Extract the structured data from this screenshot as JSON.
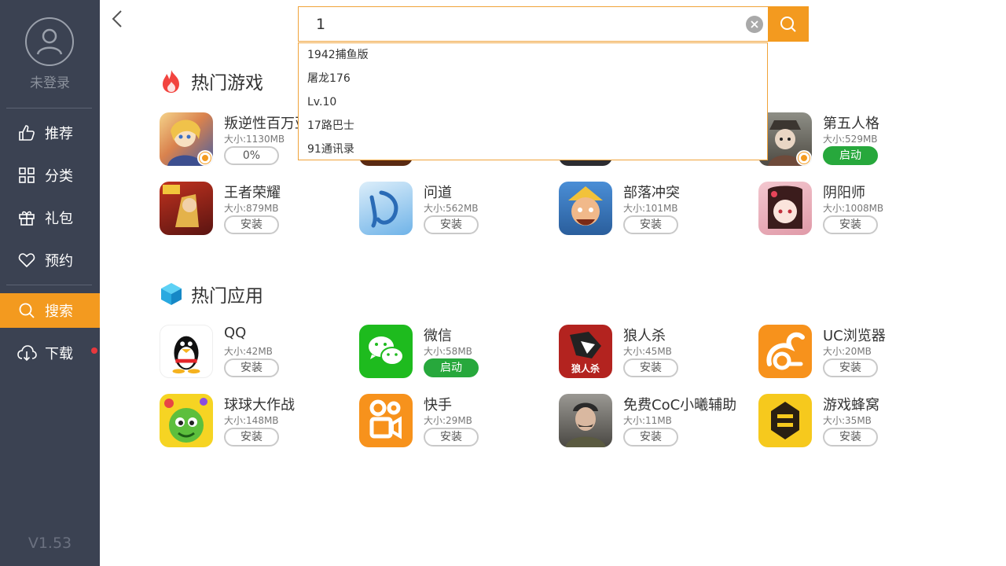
{
  "sidebar": {
    "login_label": "未登录",
    "nav": [
      {
        "label": "推荐",
        "icon": "thumbs-up-icon"
      },
      {
        "label": "分类",
        "icon": "grid-icon"
      },
      {
        "label": "礼包",
        "icon": "gift-icon"
      },
      {
        "label": "预约",
        "icon": "heart-icon"
      },
      {
        "label": "搜索",
        "icon": "search-icon",
        "active": true
      },
      {
        "label": "下载",
        "icon": "cloud-download-icon"
      }
    ],
    "version": "V1.53"
  },
  "search": {
    "value": "1",
    "suggestions": [
      "1942捕鱼版",
      "屠龙176",
      "Lv.10",
      "17路巴士",
      "91通讯录"
    ]
  },
  "hot_games": {
    "title": "热门游戏",
    "apps": [
      {
        "name": "叛逆性百万亚",
        "size": "大小:1130MB",
        "button": "0%"
      },
      {
        "name": "第五人格",
        "size": "大小:529MB",
        "button": "启动"
      },
      {
        "name": "王者荣耀",
        "size": "大小:879MB",
        "button": "安装"
      },
      {
        "name": "问道",
        "size": "大小:562MB",
        "button": "安装"
      },
      {
        "name": "部落冲突",
        "size": "大小:101MB",
        "button": "安装"
      },
      {
        "name": "阴阳师",
        "size": "大小:1008MB",
        "button": "安装"
      }
    ]
  },
  "hot_apps": {
    "title": "热门应用",
    "apps": [
      {
        "name": "QQ",
        "size": "大小:42MB",
        "button": "安装"
      },
      {
        "name": "微信",
        "size": "大小:58MB",
        "button": "启动"
      },
      {
        "name": "狼人杀",
        "size": "大小:45MB",
        "button": "安装",
        "icon_text": "狼人杀"
      },
      {
        "name": "UC浏览器",
        "size": "大小:20MB",
        "button": "安装"
      },
      {
        "name": "球球大作战",
        "size": "大小:148MB",
        "button": "安装"
      },
      {
        "name": "快手",
        "size": "大小:29MB",
        "button": "安装"
      },
      {
        "name": "免费CoC小曦辅助",
        "size": "大小:11MB",
        "button": "安装"
      },
      {
        "name": "游戏蜂窝",
        "size": "大小:35MB",
        "button": "安装"
      }
    ]
  },
  "colors": {
    "accent": "#f39a1f",
    "sidebar": "#3b4252",
    "green": "#27a83c"
  }
}
